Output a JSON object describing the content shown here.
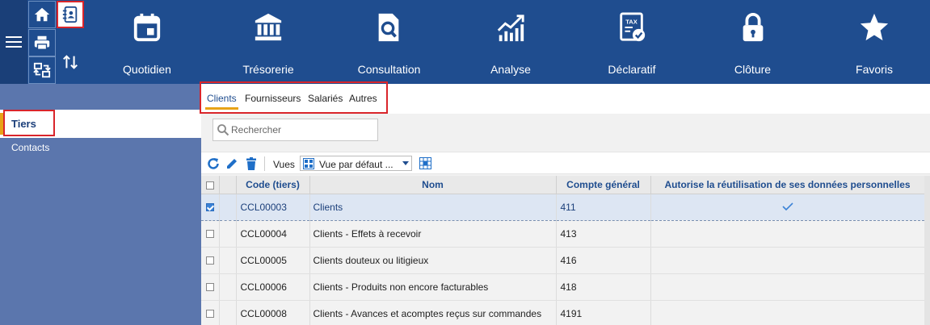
{
  "top_nav": {
    "items": [
      {
        "label": "Quotidien",
        "icon": "calendar-icon"
      },
      {
        "label": "Trésorerie",
        "icon": "bank-icon"
      },
      {
        "label": "Consultation",
        "icon": "document-search-icon"
      },
      {
        "label": "Analyse",
        "icon": "chart-trend-icon"
      },
      {
        "label": "Déclaratif",
        "icon": "tax-document-icon",
        "icon_text": "TAX"
      },
      {
        "label": "Clôture",
        "icon": "lock-icon"
      },
      {
        "label": "Favoris",
        "icon": "star-icon"
      }
    ]
  },
  "quick_buttons": [
    "home-icon",
    "print-icon",
    "transfer-icon",
    "directory-icon",
    "sort-arrows-icon"
  ],
  "sidebar": {
    "items": [
      {
        "label": "Tiers",
        "selected": true
      },
      {
        "label": "Contacts",
        "selected": false
      }
    ]
  },
  "tabs": [
    {
      "label": "Clients",
      "active": true
    },
    {
      "label": "Fournisseurs",
      "active": false
    },
    {
      "label": "Salariés",
      "active": false
    },
    {
      "label": "Autres",
      "active": false
    }
  ],
  "search": {
    "placeholder": "Rechercher",
    "value": ""
  },
  "toolbar": {
    "vues_label": "Vues",
    "vues_selected": "Vue par défaut ..."
  },
  "table": {
    "columns": [
      "Code (tiers)",
      "Nom",
      "Compte général",
      "Autorise la réutilisation de ses données personnelles"
    ],
    "rows": [
      {
        "checked": true,
        "code": "CCL00003",
        "nom": "Clients",
        "compte": "411",
        "reutilisation": true
      },
      {
        "checked": false,
        "code": "CCL00004",
        "nom": "Clients - Effets à recevoir",
        "compte": "413",
        "reutilisation": false
      },
      {
        "checked": false,
        "code": "CCL00005",
        "nom": "Clients douteux ou litigieux",
        "compte": "416",
        "reutilisation": false
      },
      {
        "checked": false,
        "code": "CCL00006",
        "nom": "Clients - Produits non encore facturables",
        "compte": "418",
        "reutilisation": false
      },
      {
        "checked": false,
        "code": "CCL00008",
        "nom": "Clients - Avances et acomptes reçus sur commandes",
        "compte": "4191",
        "reutilisation": false
      }
    ]
  },
  "colors": {
    "topbar": "#1f4d8f",
    "sidebar": "#5b76ad",
    "accent": "#e8a317",
    "highlight_box": "#d9252b"
  }
}
